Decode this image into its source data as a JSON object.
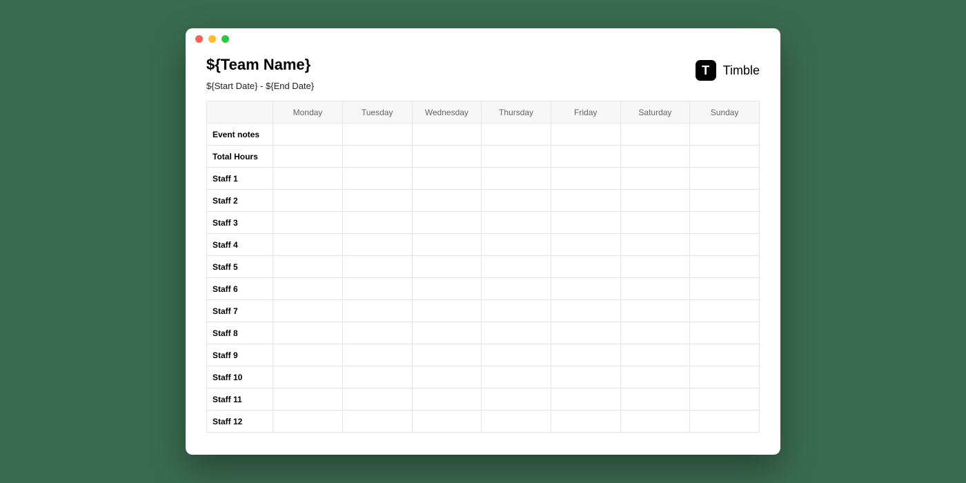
{
  "brand": {
    "logo_letter": "T",
    "name": "Timble"
  },
  "header": {
    "title": "${Team Name}",
    "date_range": "${Start Date} - ${End Date}"
  },
  "table": {
    "columns": [
      "Monday",
      "Tuesday",
      "Wednesday",
      "Thursday",
      "Friday",
      "Saturday",
      "Sunday"
    ],
    "rows": [
      "Event notes",
      "Total Hours",
      "Staff 1",
      "Staff 2",
      "Staff 3",
      "Staff 4",
      "Staff 5",
      "Staff 6",
      "Staff 7",
      "Staff 8",
      "Staff 9",
      "Staff 10",
      "Staff 11",
      "Staff 12"
    ]
  }
}
